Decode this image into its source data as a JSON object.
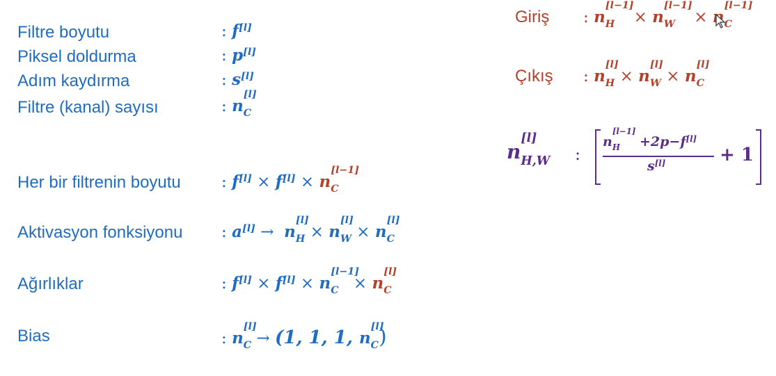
{
  "left_labels": {
    "filter_size": "Filtre boyutu",
    "padding": "Piksel doldurma",
    "stride": "Adım kaydırma",
    "filter_count": "Filtre (kanal) sayısı",
    "each_filter_size": "Her bir filtrenin boyutu",
    "activation": "Aktivasyon fonksiyonu",
    "weights": "Ağırlıklar",
    "bias": "Bias"
  },
  "right_labels": {
    "input": "Giriş",
    "output": "Çıkış"
  },
  "symbols": {
    "colon": ":",
    "f": "f",
    "p": "p",
    "s": "s",
    "n": "n",
    "a": "a",
    "l": "[l]",
    "l_minus_1": "[l−1]",
    "H": "H",
    "W": "W",
    "C": "C",
    "HW": "H,W",
    "times": "×",
    "arrow": "→",
    "bias_tuple_start": "(1, 1, 1, ",
    "bias_tuple_end": ")",
    "plus_2p_minus": "+2p−",
    "plus_one": "+ 1"
  },
  "colors": {
    "blue": "#1f6cc0",
    "red": "#b4412a",
    "purple": "#5a2d8a"
  },
  "icons": {
    "cursor": "mouse-pointer-icon"
  }
}
